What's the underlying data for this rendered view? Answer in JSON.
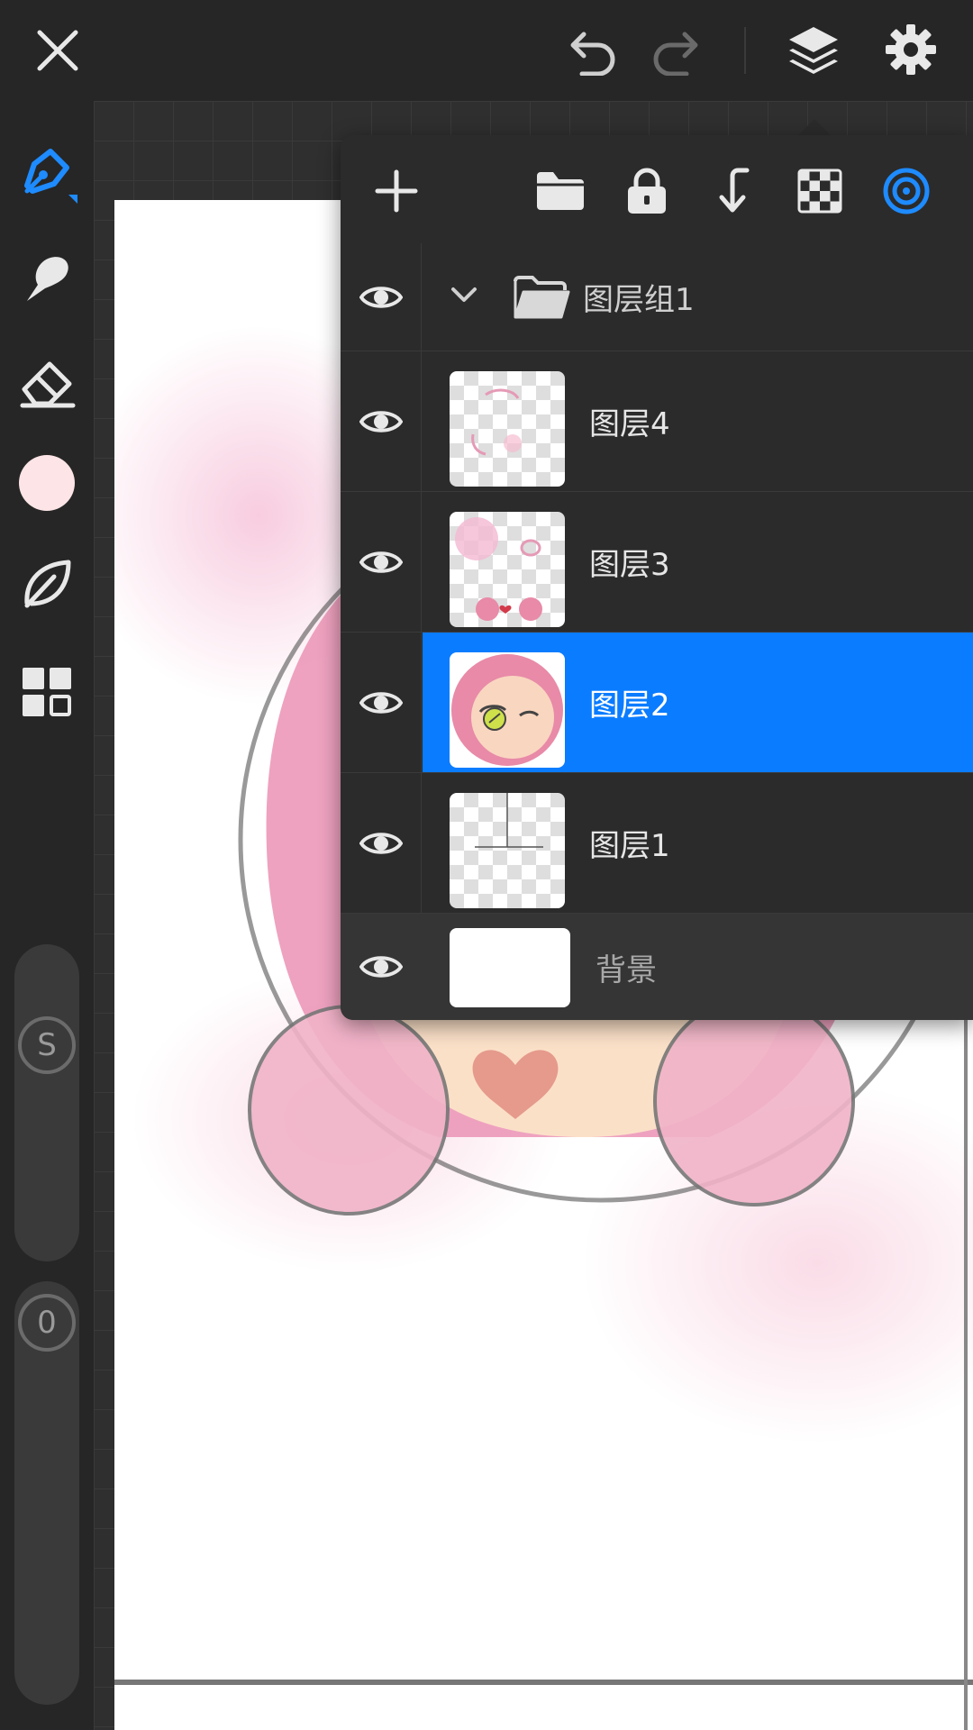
{
  "toolbar": {
    "close_icon": "close-icon",
    "undo_icon": "undo-icon",
    "redo_icon": "redo-icon",
    "layers_icon": "layers-icon",
    "settings_icon": "gear-icon"
  },
  "leftbar": {
    "tools": [
      "pen-tool",
      "smudge-tool",
      "eraser-tool",
      "color-swatch",
      "leaf-tool",
      "grid-tool"
    ],
    "color": "#fde4e6",
    "accent": "#1e8bff",
    "size_slider_label": "S",
    "opacity_slider_label": "0"
  },
  "layers_panel": {
    "toolbar_icons": [
      "add-icon",
      "folder-icon",
      "lock-icon",
      "merge-down-icon",
      "transparency-icon",
      "target-icon"
    ],
    "group": {
      "name": "图层组1",
      "expanded": true
    },
    "layers": [
      {
        "name": "图层4",
        "visible": true,
        "selected": false
      },
      {
        "name": "图层3",
        "visible": true,
        "selected": false
      },
      {
        "name": "图层2",
        "visible": true,
        "selected": true
      },
      {
        "name": "图层1",
        "visible": true,
        "selected": false
      }
    ],
    "background": {
      "name": "背景",
      "visible": true
    },
    "selected_color": "#0a7cff"
  }
}
